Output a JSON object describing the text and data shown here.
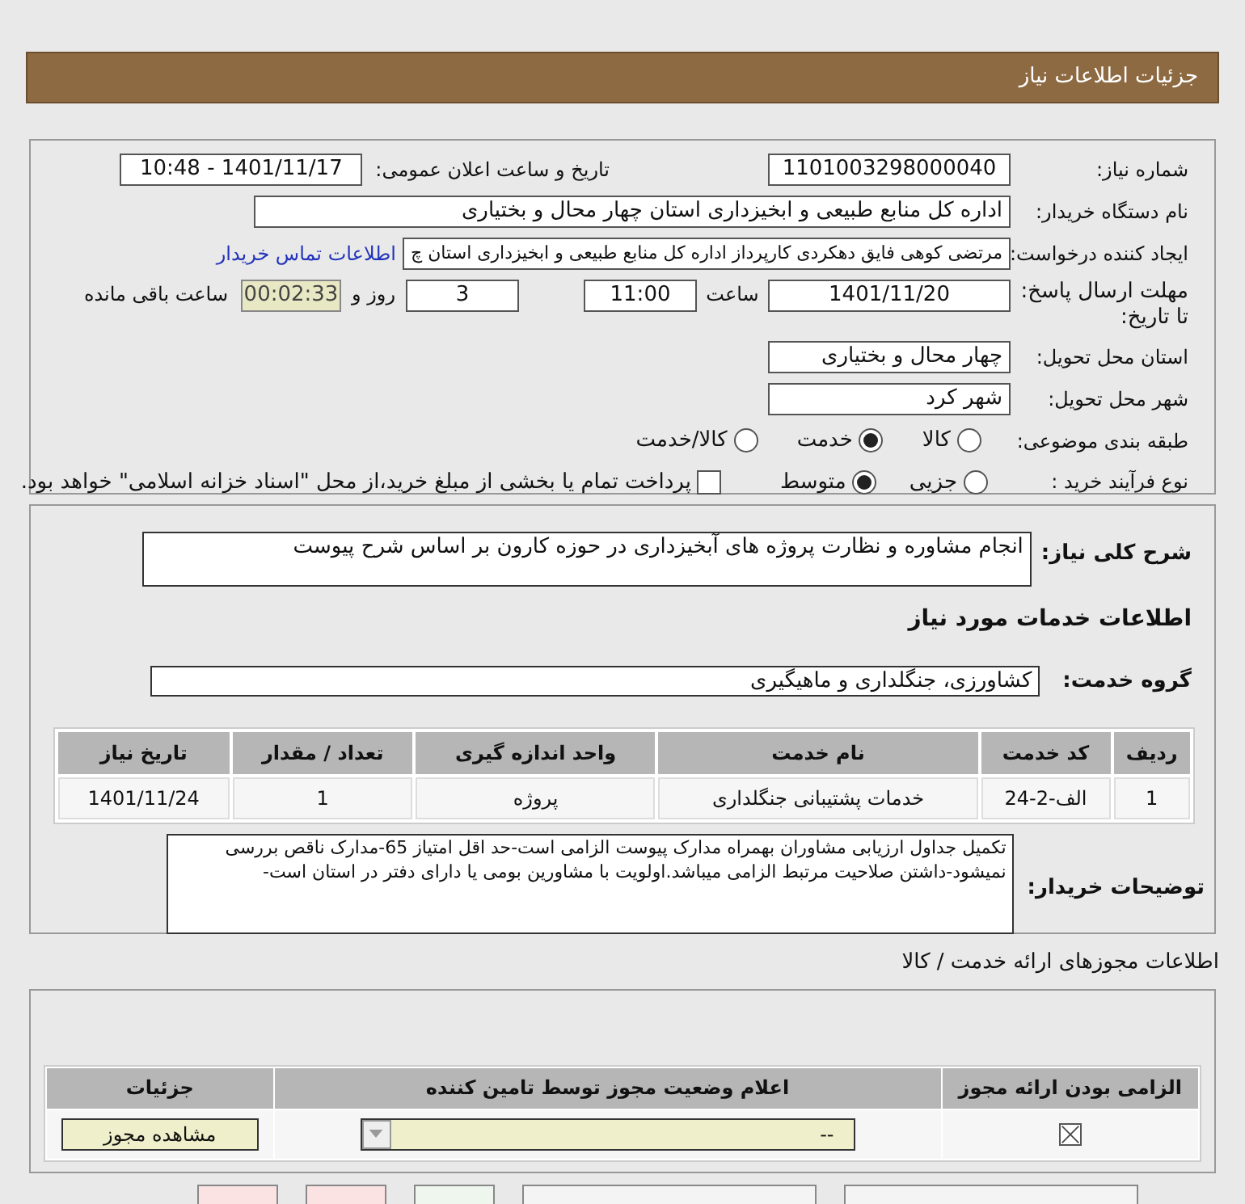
{
  "header": {
    "title": "جزئیات اطلاعات نیاز"
  },
  "need_number": {
    "label": "شماره نیاز:",
    "value": "1101003298000040"
  },
  "announce": {
    "label": "تاریخ و ساعت اعلان عمومی:",
    "value": "1401/11/17 - 10:48"
  },
  "buyer": {
    "label": "نام دستگاه خریدار:",
    "value": "اداره کل منابع طبیعی و ابخیزداری استان چهار محال و بختیاری"
  },
  "requester": {
    "label": "ایجاد کننده درخواست:",
    "value": "مرتضی کوهی فایق دهکردی کارپرداز اداره کل منابع طبیعی و ابخیزداری استان چ",
    "link": "اطلاعات تماس خریدار"
  },
  "deadline": {
    "label": "مهلت ارسال پاسخ: تا تاریخ:",
    "date": "1401/11/20",
    "time_label": "ساعت",
    "time": "11:00",
    "days": "3",
    "days_label": "روز و",
    "remaining": "00:02:33",
    "remaining_label": "ساعت باقی مانده"
  },
  "province": {
    "label": "استان محل تحویل:",
    "value": "چهار محال و بختیاری"
  },
  "city": {
    "label": "شهر محل تحویل:",
    "value": "شهر کرد"
  },
  "category": {
    "label": "طبقه بندی موضوعی:",
    "options": [
      {
        "label": "کالا",
        "selected": false
      },
      {
        "label": "خدمت",
        "selected": true
      },
      {
        "label": "کالا/خدمت",
        "selected": false
      }
    ]
  },
  "purchase_type": {
    "label": "نوع فرآیند خرید :",
    "options": [
      {
        "label": "جزیی",
        "selected": false
      },
      {
        "label": "متوسط",
        "selected": true
      }
    ],
    "payment": {
      "checked": false,
      "label": "پرداخت تمام یا بخشی از مبلغ خرید،از محل \"اسناد خزانه اسلامی\" خواهد بود."
    }
  },
  "summary": {
    "label": "شرح کلی نیاز:",
    "value": "انجام مشاوره و نظارت پروژه های آبخیزداری در حوزه کارون بر اساس شرح پیوست"
  },
  "services_title": "اطلاعات خدمات مورد نیاز",
  "service_group": {
    "label": "گروه خدمت:",
    "value": "کشاورزی، جنگلداری و ماهیگیری"
  },
  "table": {
    "columns": [
      "ردیف",
      "کد خدمت",
      "نام خدمت",
      "واحد اندازه گیری",
      "تعداد / مقدار",
      "تاریخ نیاز"
    ],
    "rows": [
      [
        "1",
        "الف-2-24",
        "خدمات پشتیبانی جنگلداری",
        "پروژه",
        "1",
        "1401/11/24"
      ]
    ]
  },
  "buyer_notes": {
    "label": "توضیحات خریدار:",
    "value": "تکمیل جداول ارزیابی مشاوران بهمراه مدارک پیوست الزامی است-حد اقل امتیاز 65-مدارک ناقص بررسی نمیشود-داشتن صلاحیت مرتبط الزامی میباشد.اولویت با مشاورین بومی یا دارای دفتر در استان است-"
  },
  "permits": {
    "title": "اطلاعات مجوزهای ارائه خدمت / کالا",
    "columns": [
      "الزامی بودن ارائه مجوز",
      "اعلام وضعیت مجوز توسط تامین کننده",
      "جزئیات"
    ],
    "rows": [
      {
        "required": true,
        "status": "--",
        "button": "مشاهده مجوز"
      }
    ]
  },
  "footer_buttons": [
    {
      "kind": "wide"
    },
    {
      "kind": "wide"
    },
    {
      "kind": "plain"
    },
    {
      "kind": "danger"
    },
    {
      "kind": "danger"
    }
  ]
}
